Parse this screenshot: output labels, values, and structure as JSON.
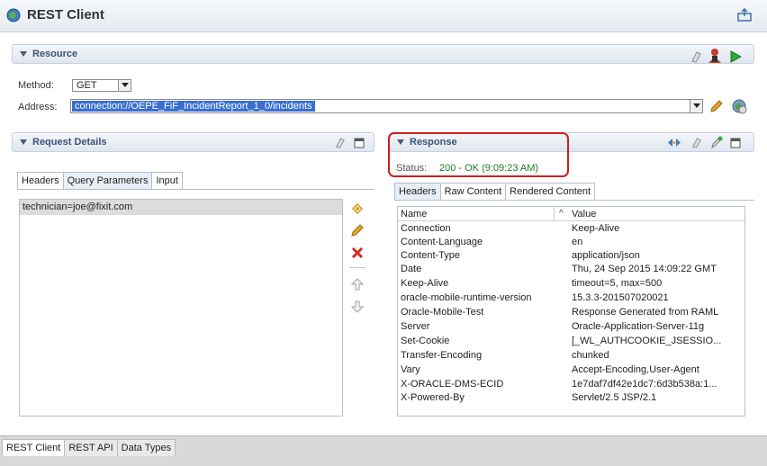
{
  "app": {
    "title": "REST Client"
  },
  "resource": {
    "title": "Resource",
    "method_label": "Method:",
    "method_value": "GET",
    "address_label": "Address:",
    "address_value": "connection://OEPE_FiF_IncidentReport_1_0/incidents"
  },
  "request": {
    "title": "Request Details",
    "tabs": [
      {
        "label": "Headers",
        "active": false
      },
      {
        "label": "Query Parameters",
        "active": true
      },
      {
        "label": "Input",
        "active": false
      }
    ],
    "query_params": [
      "technician=joe@fixit.com"
    ]
  },
  "response": {
    "title": "Response",
    "status_label": "Status:",
    "status_value": "200 - OK (9:09:23 AM)",
    "tabs": [
      {
        "label": "Headers",
        "active": true
      },
      {
        "label": "Raw Content",
        "active": false
      },
      {
        "label": "Rendered Content",
        "active": false
      }
    ],
    "columns": {
      "name": "Name",
      "sort": "^",
      "value": "Value"
    },
    "rows": [
      {
        "name": "Connection",
        "value": "Keep-Alive"
      },
      {
        "name": "Content-Language",
        "value": "en"
      },
      {
        "name": "Content-Type",
        "value": "application/json"
      },
      {
        "name": "Date",
        "value": "Thu, 24 Sep 2015 14:09:22 GMT"
      },
      {
        "name": "Keep-Alive",
        "value": "timeout=5, max=500"
      },
      {
        "name": "oracle-mobile-runtime-version",
        "value": "15.3.3-201507020021"
      },
      {
        "name": "Oracle-Mobile-Test",
        "value": "Response Generated from RAML"
      },
      {
        "name": "Server",
        "value": "Oracle-Application-Server-11g"
      },
      {
        "name": "Set-Cookie",
        "value": "[_WL_AUTHCOOKIE_JSESSIO..."
      },
      {
        "name": "Transfer-Encoding",
        "value": "chunked"
      },
      {
        "name": "Vary",
        "value": "Accept-Encoding,User-Agent"
      },
      {
        "name": "X-ORACLE-DMS-ECID",
        "value": "1e7daf7df42e1dc7:6d3b538a:1..."
      },
      {
        "name": "X-Powered-By",
        "value": "Servlet/2.5 JSP/2.1"
      }
    ]
  },
  "bottom_tabs": [
    {
      "label": "REST Client",
      "active": true
    },
    {
      "label": "REST API",
      "active": false
    },
    {
      "label": "Data Types",
      "active": false
    }
  ],
  "colors": {
    "status_ok": "#1e7d22",
    "highlight": "#cc1f1f",
    "selection": "#3a6fd0"
  },
  "icons": {
    "app": "globe-rest-icon",
    "window": "export-icon",
    "clear": "eraser-icon",
    "user": "user-icon",
    "run": "play-icon",
    "edit": "pencil-icon",
    "web": "web-browser-icon",
    "add": "add-param-icon",
    "delete": "delete-icon",
    "up": "move-up-icon",
    "down": "move-down-icon",
    "maximize": "maximize-icon",
    "nav": "navigate-icon",
    "pin": "pin-icon"
  }
}
